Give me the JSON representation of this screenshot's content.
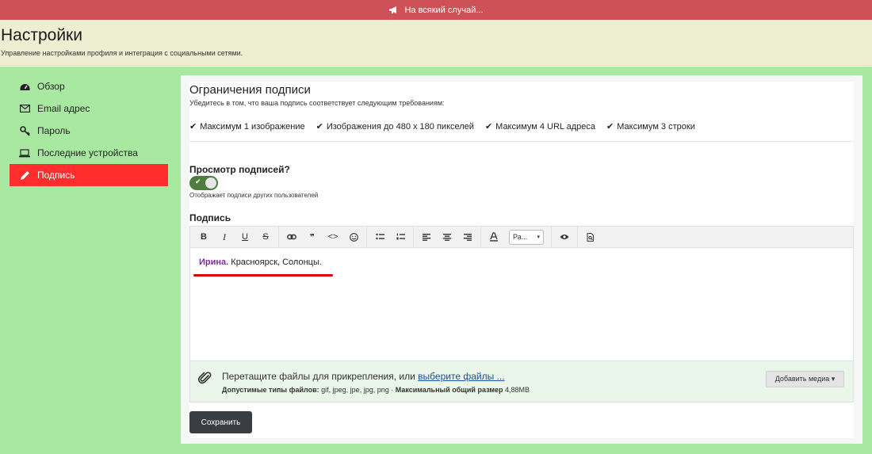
{
  "announcement": {
    "text": "На всякий случай...",
    "icon": "megaphone-icon"
  },
  "header": {
    "title": "Настройки",
    "subtitle": "Управление настройками профиля и интеграция с социальными сетями."
  },
  "sidebar": {
    "items": [
      {
        "label": "Обзор",
        "icon": "dashboard-icon"
      },
      {
        "label": "Email адрес",
        "icon": "envelope-icon"
      },
      {
        "label": "Пароль",
        "icon": "key-icon"
      },
      {
        "label": "Последние устройства",
        "icon": "laptop-icon"
      },
      {
        "label": "Подпись",
        "icon": "pencil-icon",
        "active": true
      }
    ],
    "active_color": "#ff2d2d"
  },
  "limits": {
    "title": "Ограничения подписи",
    "description": "Убедитесь в том, что ваша подпись соответствует следующим требованиям:",
    "items": [
      "Максимум 1 изображение",
      "Изображения до 480 x 180 пикселей",
      "Максимум 4 URL адреса",
      "Максимум 3 строки"
    ]
  },
  "preview": {
    "label": "Просмотр подписей?",
    "hint": "Отображает подписи других пользователей",
    "enabled": true
  },
  "signature": {
    "label": "Подпись",
    "name": "Ирина.",
    "text": "Красноярск, Солонцы.",
    "name_color": "#7a2b9a"
  },
  "toolbar": {
    "bold": "B",
    "italic": "I",
    "underline": "U",
    "strike": "S",
    "quote": "❞",
    "code": "<>",
    "font_size": "Ра..."
  },
  "attachments": {
    "drop_text": "Перетащите файлы для прикрепления, или",
    "choose_link": "выберите файлы ...",
    "types_label": "Допустимые типы файлов:",
    "types": "gif, jpeg, jpe, jpg, png",
    "size_label": "Максимальный общий размер",
    "size": "4,88MB",
    "media_button": "Добавить медиа ▾"
  },
  "actions": {
    "save": "Сохранить"
  },
  "colors": {
    "topbar": "#cd5157",
    "header": "#eeeed2",
    "background": "#a9e8a1",
    "save": "#3a3d42"
  }
}
